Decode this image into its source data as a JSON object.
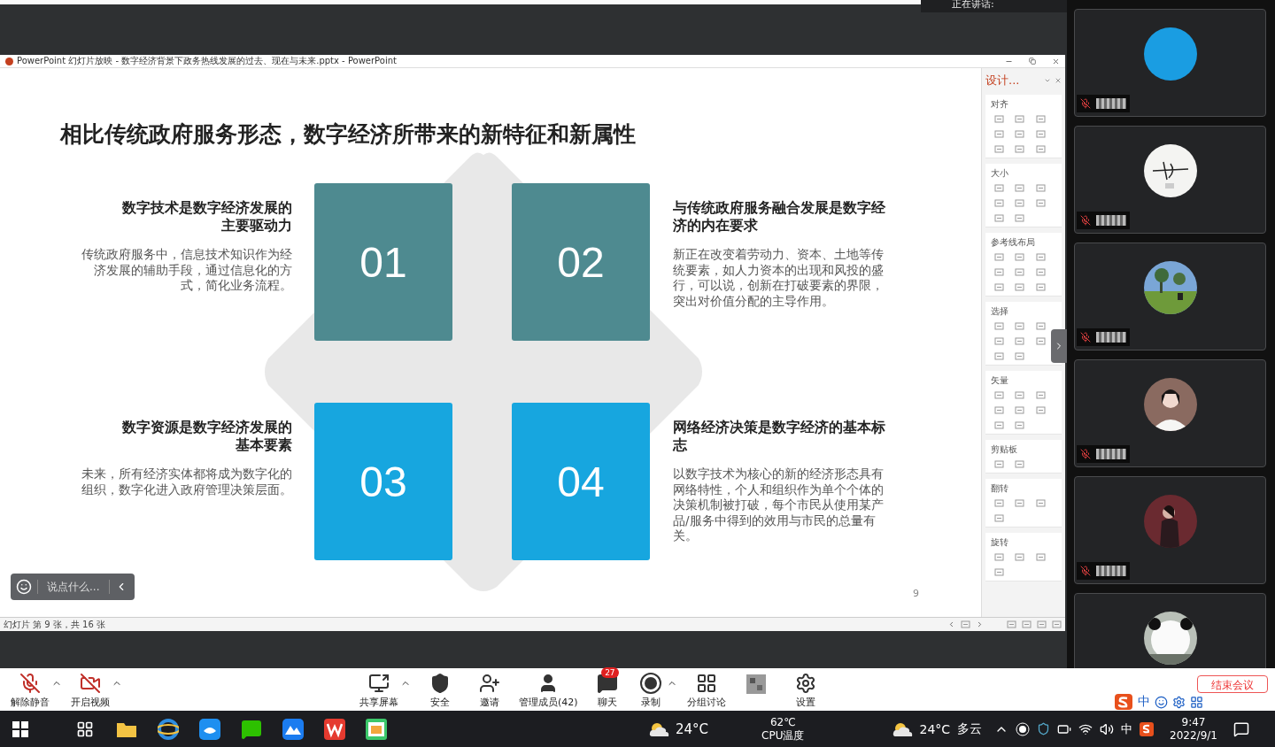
{
  "speaking_banner": "正在讲话:",
  "powerpoint": {
    "title": "PowerPoint 幻灯片放映 - 数字经济背景下政务热线发展的过去、现在与未来.pptx - PowerPoint",
    "status": "幻灯片 第 9 张，共 16 张",
    "slide": {
      "title": "相比传统政府服务形态，数字经济所带来的新特征和新属性",
      "page_number": "9",
      "cards": [
        {
          "number": "01",
          "color": "#4e8a90",
          "heading": "数字技术是数字经济发展的主要驱动力",
          "body": "传统政府服务中，信息技术知识作为经济发展的辅助手段，通过信息化的方式，简化业务流程。"
        },
        {
          "number": "02",
          "color": "#4e8a90",
          "heading": "与传统政府服务融合发展是数字经济的内在要求",
          "body": "新正在改变着劳动力、资本、土地等传统要素，如人力资本的出现和风投的盛行，可以说，创新在打破要素的界限，突出对价值分配的主导作用。"
        },
        {
          "number": "03",
          "color": "#17a6df",
          "heading": "数字资源是数字经济发展的基本要素",
          "body": "未来，所有经济实体都将成为数字化的组织，数字化进入政府管理决策层面。"
        },
        {
          "number": "04",
          "color": "#17a6df",
          "heading": "网络经济决策是数字经济的基本标志",
          "body": "以数字技术为核心的新的经济形态具有网络特性，个人和组织作为单个个体的决策机制被打破，每个市民从使用某产品/服务中得到的效用与市民的总量有关。"
        }
      ]
    },
    "comment_field": {
      "placeholder": "说点什么..."
    },
    "design_pane": {
      "title": "设计...",
      "sections": [
        "对齐",
        "大小",
        "参考线布局",
        "选择",
        "矢量",
        "剪贴板",
        "翻转",
        "旋转"
      ]
    }
  },
  "participants": [
    {
      "avatar": {
        "kind": "solid",
        "color": "#1a9de2"
      },
      "muted": true
    },
    {
      "avatar": {
        "kind": "picture"
      },
      "muted": true
    },
    {
      "avatar": {
        "kind": "picture"
      },
      "muted": true
    },
    {
      "avatar": {
        "kind": "picture"
      },
      "muted": true
    },
    {
      "avatar": {
        "kind": "picture"
      },
      "muted": true
    },
    {
      "avatar": {
        "kind": "picture"
      }
    }
  ],
  "toolbar": {
    "left": [
      {
        "kind": "mic",
        "label": "解除静音",
        "caret": true
      },
      {
        "kind": "video",
        "label": "开启视频",
        "caret": true
      }
    ],
    "center": [
      {
        "kind": "share",
        "label": "共享屏幕",
        "caret": true
      },
      {
        "kind": "security",
        "label": "安全",
        "caret": false
      },
      {
        "kind": "invite",
        "label": "邀请",
        "caret": false
      },
      {
        "kind": "members",
        "label": "管理成员(42)",
        "caret": false
      },
      {
        "kind": "chat",
        "label": "聊天",
        "caret": false,
        "badge": "27"
      },
      {
        "kind": "record",
        "label": "录制",
        "caret": true
      },
      {
        "kind": "breakout",
        "label": "分组讨论",
        "caret": false
      },
      {
        "kind": "blurred",
        "caret": false
      },
      {
        "kind": "settings",
        "label": "设置",
        "caret": false
      }
    ],
    "end_button": "结束会议"
  },
  "ime_bar": {
    "mode": "中"
  },
  "taskbar": {
    "weather": "24°C",
    "cpu_temp": "62℃",
    "cpu_label": "CPU温度",
    "weather2_temp": "24°C",
    "weather2_text": "多云",
    "input_mode": "中",
    "time": "9:47",
    "date": "2022/9/1"
  }
}
